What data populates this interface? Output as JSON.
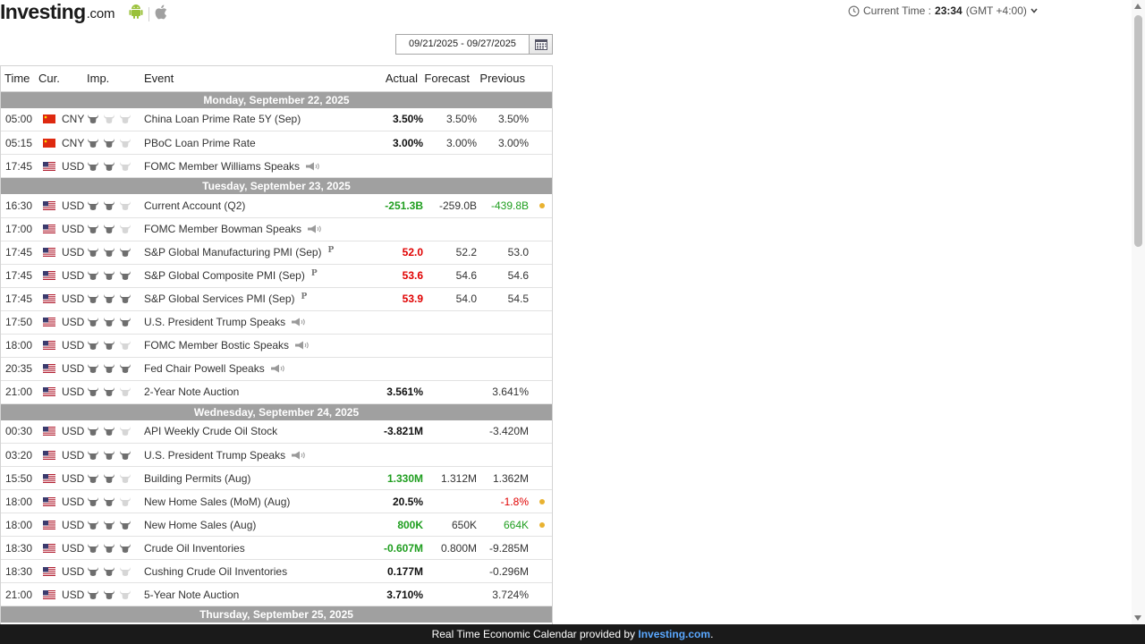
{
  "header": {
    "logo_main": "Investing",
    "logo_com": ".com",
    "current_time_label": "Current Time :",
    "current_time_value": "23:34",
    "timezone": "(GMT +4:00)"
  },
  "date_range": {
    "value": "09/21/2025 - 09/27/2025"
  },
  "columns": {
    "time": "Time",
    "cur": "Cur.",
    "imp": "Imp.",
    "event": "Event",
    "actual": "Actual",
    "forecast": "Forecast",
    "previous": "Previous"
  },
  "colors": {
    "green": "#1f9e1f",
    "red": "#e00000",
    "day_bar": "#a0a0a0",
    "alert_dot": "#e9b230"
  },
  "days": [
    {
      "label": "Monday, September 22, 2025",
      "events": [
        {
          "time": "05:00",
          "currency": "CNY",
          "flag": "cn",
          "importance": 1,
          "event": "China Loan Prime Rate 5Y (Sep)",
          "actual": "3.50%",
          "actual_color": "",
          "forecast": "3.50%",
          "previous": "3.50%",
          "previous_color": "",
          "speech": false,
          "prelim": "",
          "alert": false
        },
        {
          "time": "05:15",
          "currency": "CNY",
          "flag": "cn",
          "importance": 2,
          "event": "PBoC Loan Prime Rate",
          "actual": "3.00%",
          "actual_color": "",
          "forecast": "3.00%",
          "previous": "3.00%",
          "previous_color": "",
          "speech": false,
          "prelim": "",
          "alert": false
        },
        {
          "time": "17:45",
          "currency": "USD",
          "flag": "us",
          "importance": 2,
          "event": "FOMC Member Williams Speaks",
          "actual": "",
          "actual_color": "",
          "forecast": "",
          "previous": "",
          "previous_color": "",
          "speech": true,
          "prelim": "",
          "alert": false
        }
      ]
    },
    {
      "label": "Tuesday, September 23, 2025",
      "events": [
        {
          "time": "16:30",
          "currency": "USD",
          "flag": "us",
          "importance": 2,
          "event": "Current Account (Q2)",
          "actual": "-251.3B",
          "actual_color": "green",
          "forecast": "-259.0B",
          "previous": "-439.8B",
          "previous_color": "green",
          "speech": false,
          "prelim": "",
          "alert": true
        },
        {
          "time": "17:00",
          "currency": "USD",
          "flag": "us",
          "importance": 2,
          "event": "FOMC Member Bowman Speaks",
          "actual": "",
          "actual_color": "",
          "forecast": "",
          "previous": "",
          "previous_color": "",
          "speech": true,
          "prelim": "",
          "alert": false
        },
        {
          "time": "17:45",
          "currency": "USD",
          "flag": "us",
          "importance": 3,
          "event": "S&P Global Manufacturing PMI (Sep)",
          "actual": "52.0",
          "actual_color": "red",
          "forecast": "52.2",
          "previous": "53.0",
          "previous_color": "",
          "speech": false,
          "prelim": "P",
          "alert": false
        },
        {
          "time": "17:45",
          "currency": "USD",
          "flag": "us",
          "importance": 3,
          "event": "S&P Global Composite PMI (Sep)",
          "actual": "53.6",
          "actual_color": "red",
          "forecast": "54.6",
          "previous": "54.6",
          "previous_color": "",
          "speech": false,
          "prelim": "P",
          "alert": false
        },
        {
          "time": "17:45",
          "currency": "USD",
          "flag": "us",
          "importance": 3,
          "event": "S&P Global Services PMI (Sep)",
          "actual": "53.9",
          "actual_color": "red",
          "forecast": "54.0",
          "previous": "54.5",
          "previous_color": "",
          "speech": false,
          "prelim": "P",
          "alert": false
        },
        {
          "time": "17:50",
          "currency": "USD",
          "flag": "us",
          "importance": 3,
          "event": "U.S. President Trump Speaks",
          "actual": "",
          "actual_color": "",
          "forecast": "",
          "previous": "",
          "previous_color": "",
          "speech": true,
          "prelim": "",
          "alert": false
        },
        {
          "time": "18:00",
          "currency": "USD",
          "flag": "us",
          "importance": 2,
          "event": "FOMC Member Bostic Speaks",
          "actual": "",
          "actual_color": "",
          "forecast": "",
          "previous": "",
          "previous_color": "",
          "speech": true,
          "prelim": "",
          "alert": false
        },
        {
          "time": "20:35",
          "currency": "USD",
          "flag": "us",
          "importance": 3,
          "event": "Fed Chair Powell Speaks",
          "actual": "",
          "actual_color": "",
          "forecast": "",
          "previous": "",
          "previous_color": "",
          "speech": true,
          "prelim": "",
          "alert": false
        },
        {
          "time": "21:00",
          "currency": "USD",
          "flag": "us",
          "importance": 2,
          "event": "2-Year Note Auction",
          "actual": "3.561%",
          "actual_color": "",
          "forecast": "",
          "previous": "3.641%",
          "previous_color": "",
          "speech": false,
          "prelim": "",
          "alert": false
        }
      ]
    },
    {
      "label": "Wednesday, September 24, 2025",
      "events": [
        {
          "time": "00:30",
          "currency": "USD",
          "flag": "us",
          "importance": 2,
          "event": "API Weekly Crude Oil Stock",
          "actual": "-3.821M",
          "actual_color": "",
          "forecast": "",
          "previous": "-3.420M",
          "previous_color": "",
          "speech": false,
          "prelim": "",
          "alert": false
        },
        {
          "time": "03:20",
          "currency": "USD",
          "flag": "us",
          "importance": 3,
          "event": "U.S. President Trump Speaks",
          "actual": "",
          "actual_color": "",
          "forecast": "",
          "previous": "",
          "previous_color": "",
          "speech": true,
          "prelim": "",
          "alert": false
        },
        {
          "time": "15:50",
          "currency": "USD",
          "flag": "us",
          "importance": 2,
          "event": "Building Permits (Aug)",
          "actual": "1.330M",
          "actual_color": "green",
          "forecast": "1.312M",
          "previous": "1.362M",
          "previous_color": "",
          "speech": false,
          "prelim": "",
          "alert": false
        },
        {
          "time": "18:00",
          "currency": "USD",
          "flag": "us",
          "importance": 2,
          "event": "New Home Sales (MoM) (Aug)",
          "actual": "20.5%",
          "actual_color": "",
          "forecast": "",
          "previous": "-1.8%",
          "previous_color": "red",
          "speech": false,
          "prelim": "",
          "alert": true
        },
        {
          "time": "18:00",
          "currency": "USD",
          "flag": "us",
          "importance": 3,
          "event": "New Home Sales (Aug)",
          "actual": "800K",
          "actual_color": "green",
          "forecast": "650K",
          "previous": "664K",
          "previous_color": "green",
          "speech": false,
          "prelim": "",
          "alert": true
        },
        {
          "time": "18:30",
          "currency": "USD",
          "flag": "us",
          "importance": 3,
          "event": "Crude Oil Inventories",
          "actual": "-0.607M",
          "actual_color": "green",
          "forecast": "0.800M",
          "previous": "-9.285M",
          "previous_color": "",
          "speech": false,
          "prelim": "",
          "alert": false
        },
        {
          "time": "18:30",
          "currency": "USD",
          "flag": "us",
          "importance": 2,
          "event": "Cushing Crude Oil Inventories",
          "actual": "0.177M",
          "actual_color": "",
          "forecast": "",
          "previous": "-0.296M",
          "previous_color": "",
          "speech": false,
          "prelim": "",
          "alert": false
        },
        {
          "time": "21:00",
          "currency": "USD",
          "flag": "us",
          "importance": 2,
          "event": "5-Year Note Auction",
          "actual": "3.710%",
          "actual_color": "",
          "forecast": "",
          "previous": "3.724%",
          "previous_color": "",
          "speech": false,
          "prelim": "",
          "alert": false
        }
      ]
    },
    {
      "label": "Thursday, September 25, 2025",
      "events": [
        {
          "time": "",
          "currency": "",
          "flag": "us",
          "importance": 2,
          "event": "",
          "actual": "",
          "actual_color": "",
          "forecast": "",
          "previous": "",
          "previous_color": "",
          "speech": false,
          "prelim": "",
          "alert": false
        }
      ]
    }
  ],
  "footer": {
    "text": "Real Time Economic Calendar provided by ",
    "link": "Investing.com",
    "suffix": "."
  }
}
